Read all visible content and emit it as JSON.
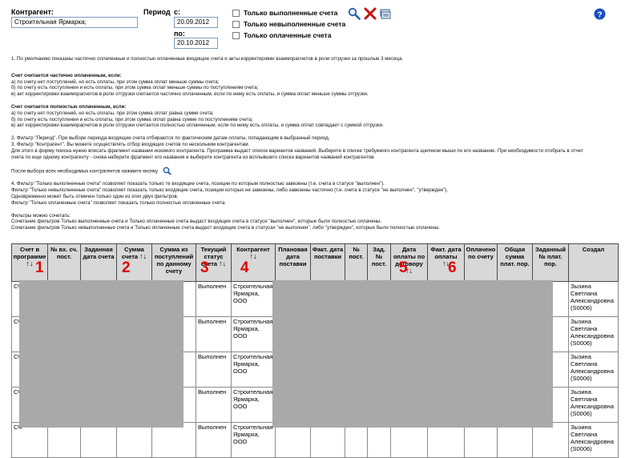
{
  "filter": {
    "counterparty_label": "Контрагент:",
    "counterparty_value": "Строительная Ярмарка;",
    "period_label": "Период",
    "from_label": "с:",
    "from_value": "20.09.2012",
    "to_label": "по:",
    "to_value": "20.10.2012",
    "checkboxes": [
      {
        "label": "Только выполненные счета",
        "checked": false
      },
      {
        "label": "Только невыполненные счета",
        "checked": false
      },
      {
        "label": "Только оплаченные счета",
        "checked": false
      }
    ]
  },
  "icons": {
    "search": "search-icon",
    "clear": "clear-icon",
    "export": "export-icon",
    "help": "help-icon"
  },
  "notes": [
    "1. По умолчанию показаны частично оплаченные и полностью оплаченные входящие счета и акты корректировки взаиморасчетов в роли отгрузки за прошлые 3 месяца.",
    "Счет считается частично оплаченным, если:",
    "а) по счету нет поступлений, но есть оплаты, при этом сумма оплат меньше суммы счета;",
    "б) по счету есть поступления и есть оплаты, при этом сумма оплат меньше суммы по поступлениям счета;",
    "в) акт корректировки взаиморасчетов в роли отгрузки считается частично оплаченным, если по нему есть оплаты, и сумма оплат меньше суммы отгрузки.",
    "Счет считается полностью оплаченным, если:",
    "а) по счету нет поступлений, но есть оплаты, при этом сумма оплат равна сумме счета;",
    "б) по счету есть поступления и есть оплаты, при этом сумма оплат равна сумме по поступлениям счета;",
    "в) акт корректировки взаиморасчетов в роли отгрузки считается полностью оплаченным, если по нему есть оплаты, и сумма оплат совпадает с суммой отгрузки.",
    "2. Фильтр \"Период\". При выборе периода входящие счета отбираются по фактическим датам оплаты, попадающим в выбранный период.",
    "3. Фильтр \"Контрагент\". Вы можете осуществлять отбор входящих счетов по нескольким контрагентам.",
    "Для этого в форму поиска нужно вписать фрагмент названия искомого контрагента. Программа выдаст список вариантов названий. Выберите в списке требуемого контрагента щелчком мыши по его названию. При необходимости отобрать в отчет",
    "счета по еще одному контрагенту - снова наберите фрагмент его названия и выберите контрагента из всплывшего списка вариантов названий контрагентов.",
    "После выбора всех необходимых контрагентов нажмите кнопку",
    "4. Фильтр \"Только выполненные счета\" позволяет показать только те входящие счета, позиции по которым полностью завезены (т.е. счета в статусе \"выполнен\").",
    "Фильтр \"Только невыполненные счета\" позволяет показать только входящие счета, позиции которых не завезены, либо завезены частично (т.е. счета в статусе \"не выполнен\", \"утвержден\").",
    "Одновременно может быть отмечен только один из этих двух фильтров.",
    "Фильтр \"Только оплаченные счета\" позволяет показать только полностью оплаченные счета.",
    "Фильтры можно сочетать:",
    "Сочетание фильтров Только выполненные счета и Только оплаченные счета выдаст входящие счета в статусе \"выполнен\", которые были полностью оплачены.",
    "Сочетание фильтров Только невыполненные счета и Только оплаченные счета выдаст входящие счета в статусах \"не выполнен\", либо \"утвержден\", которые были полностью оплачены."
  ],
  "table": {
    "columns": [
      "Счет в программе",
      "№ вх. сч. пост.",
      "Заданная дата счета",
      "Сумма счета",
      "Сумма из поступлений по данному счету",
      "Текущий статус счета",
      "Контрагент",
      "Плановая дата поставки",
      "Факт. дата поставки",
      "№ пост.",
      "Зад. № пост.",
      "Дата оплаты по договору",
      "Факт. дата оплаты",
      "Оплачено по счету",
      "Общая сумма плат. пор.",
      "Заданный № плат. пор.",
      "Создал"
    ],
    "sort_arrows": "↑↓",
    "rows": [
      {
        "invoice": "СЧ",
        "status": "Выполнен",
        "counterparty": "Строительная Ярмарка, ООО",
        "creator": "Зызина Светлана Александровна (S0006)"
      },
      {
        "invoice": "СЧ",
        "status": "Выполнен",
        "counterparty": "Строительная Ярмарка, ООО",
        "creator": "Зызина Светлана Александровна (S0006)"
      },
      {
        "invoice": "СЧ",
        "status": "Выполнен",
        "counterparty": "Строительная Ярмарка, ООО",
        "creator": "Зызина Светлана Александровна (S0006)"
      },
      {
        "invoice": "СЧ",
        "status": "Выполнен",
        "counterparty": "Строительная Ярмарка, ООО",
        "creator": "Зызина Светлана Александровна (S0006)"
      },
      {
        "invoice": "СЧ",
        "status": "Выполнен",
        "counterparty": "Строительная Ярмарка, ООО",
        "creator": "Зызина Светлана Александровна (S0006)"
      }
    ]
  },
  "markers": [
    "1",
    "2",
    "3",
    "4",
    "5",
    "6"
  ]
}
